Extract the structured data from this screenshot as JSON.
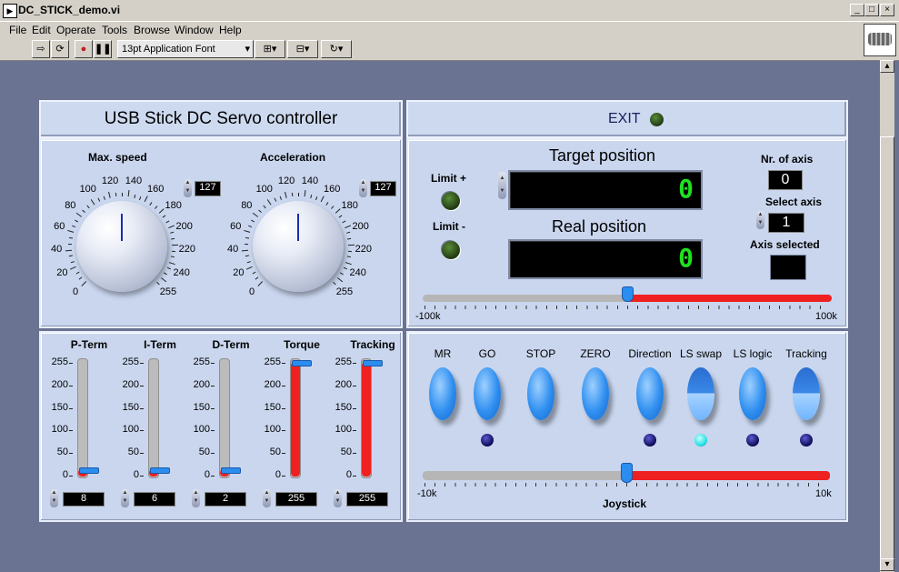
{
  "window": {
    "title": "DC_STICK_demo.vi"
  },
  "menu": [
    "File",
    "Edit",
    "Operate",
    "Tools",
    "Browse",
    "Window",
    "Help"
  ],
  "toolbar": {
    "font": "13pt Application Font"
  },
  "header": {
    "title": "USB Stick DC Servo controller",
    "exit_label": "EXIT"
  },
  "knobs": [
    {
      "label": "Max. speed",
      "value": "127"
    },
    {
      "label": "Acceleration",
      "value": "127"
    }
  ],
  "knob_scale": [
    "0",
    "20",
    "40",
    "60",
    "80",
    "100",
    "120",
    "140",
    "160",
    "180",
    "200",
    "220",
    "240",
    "255"
  ],
  "limits": {
    "plus": "Limit  +",
    "minus": "Limit  -"
  },
  "target": {
    "label": "Target position",
    "value": "0"
  },
  "real": {
    "label": "Real position",
    "value": "0"
  },
  "axis": {
    "nr_label": "Nr. of axis",
    "nr_value": "0",
    "select_label": "Select axis",
    "select_value": "1",
    "selected_label": "Axis selected"
  },
  "position_slider": {
    "min_label": "-100k",
    "max_label": "100k",
    "value_fraction": 0.5
  },
  "vsliders": [
    {
      "label": "P-Term",
      "value": "8",
      "fill": 0.03
    },
    {
      "label": "I-Term",
      "value": "6",
      "fill": 0.02
    },
    {
      "label": "D-Term",
      "value": "2",
      "fill": 0.01
    },
    {
      "label": "Torque",
      "value": "255",
      "fill": 1.0
    },
    {
      "label": "Tracking",
      "value": "255",
      "fill": 1.0
    }
  ],
  "vscale": [
    "255",
    "200",
    "150",
    "100",
    "50",
    "0"
  ],
  "buttons": [
    {
      "label": "MR",
      "led": null
    },
    {
      "label": "GO",
      "led": "blue"
    },
    {
      "label": "STOP",
      "led": null
    },
    {
      "label": "ZERO",
      "led": null
    },
    {
      "label": "Direction",
      "led": "blue"
    },
    {
      "label": "LS swap",
      "led": "cyan"
    },
    {
      "label": "LS logic",
      "led": "blue"
    },
    {
      "label": "Tracking",
      "led": "blue"
    }
  ],
  "joystick": {
    "label": "Joystick",
    "min_label": "-10k",
    "max_label": "10k",
    "value_fraction": 0.5
  }
}
